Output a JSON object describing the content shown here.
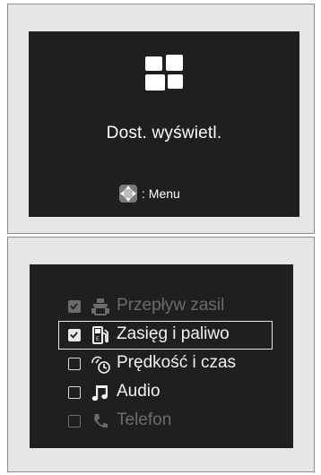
{
  "top_panel": {
    "title": "Dost. wyświetl.",
    "menu_hint": ": Menu",
    "icons": [
      "display-layout-icon",
      "directional-pad-icon"
    ]
  },
  "bottom_panel": {
    "items": [
      {
        "label": "Przepływ zasil",
        "checked": true,
        "state": "dimmed",
        "icon": "power-flow-icon"
      },
      {
        "label": "Zasięg i paliwo",
        "checked": true,
        "state": "selected",
        "icon": "fuel-pump-icon"
      },
      {
        "label": "Prędkość i czas",
        "checked": false,
        "state": "normal",
        "icon": "speed-time-icon"
      },
      {
        "label": "Audio",
        "checked": false,
        "state": "normal",
        "icon": "music-note-icon"
      },
      {
        "label": "Telefon",
        "checked": false,
        "state": "dimmed",
        "icon": "phone-icon"
      }
    ]
  },
  "colors": {
    "screen_background": "#1f1f1f",
    "panel_background": "#e6e6e6",
    "text": "#ffffff",
    "dimmed_text": "#6c6c6c"
  }
}
